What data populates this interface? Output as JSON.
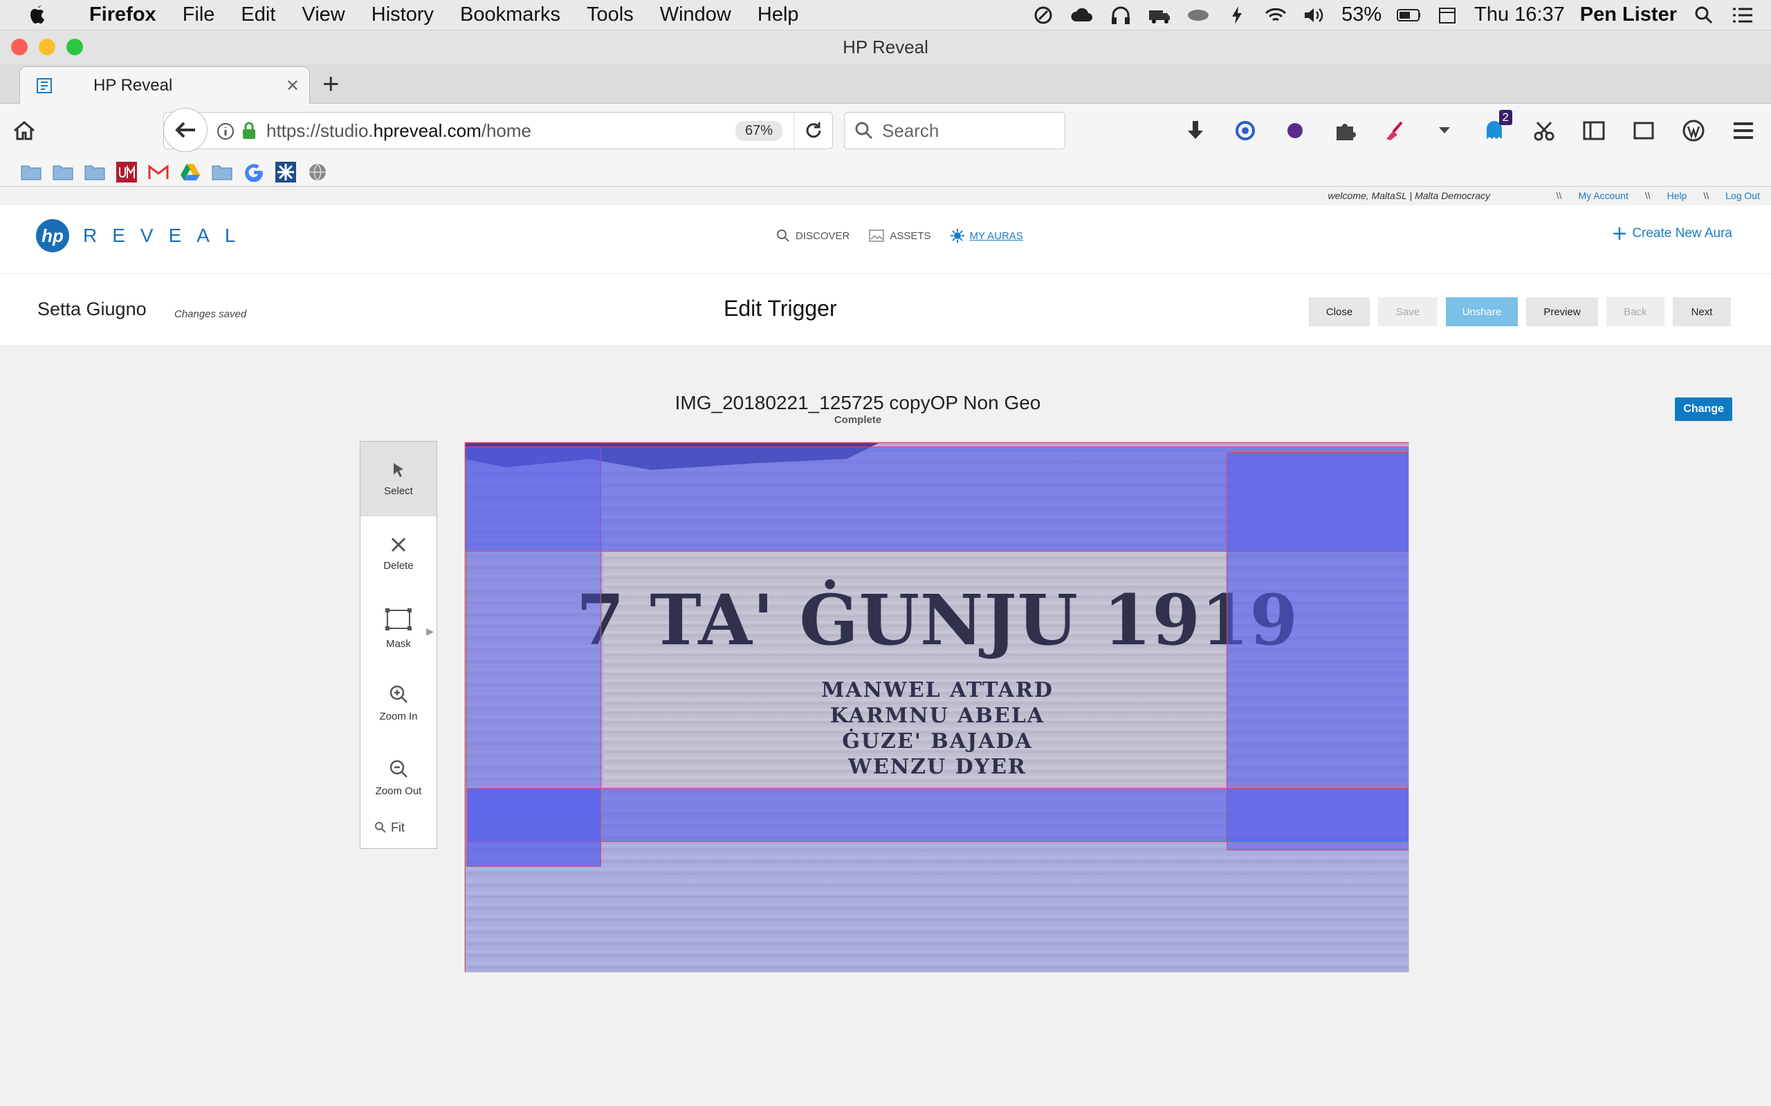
{
  "menubar": {
    "app": "Firefox",
    "items": [
      "File",
      "Edit",
      "View",
      "History",
      "Bookmarks",
      "Tools",
      "Window",
      "Help"
    ],
    "battery": "53%",
    "clock": "Thu 16:37",
    "user": "Pen Lister"
  },
  "window": {
    "title": "HP Reveal"
  },
  "tabs": [
    {
      "label": "HP Reveal"
    }
  ],
  "navbar": {
    "url_prefix": "https://studio.",
    "url_domain": "hpreveal.com",
    "url_path": "/home",
    "zoom": "67%",
    "search_placeholder": "Search",
    "notification_count": "2"
  },
  "site": {
    "welcome": "welcome, MaltaSL | Malta Democracy",
    "links": [
      "My Account",
      "Help",
      "Log Out"
    ],
    "separator": "\\\\",
    "logo_mark": "hp",
    "logo_text": "REVEAL",
    "nav": [
      {
        "label": "DISCOVER",
        "icon": "search-icon"
      },
      {
        "label": "ASSETS",
        "icon": "image-icon"
      },
      {
        "label": "MY AURAS",
        "icon": "aura-icon",
        "active": true
      }
    ],
    "create_new": "Create New Aura"
  },
  "editbar": {
    "aura_name": "Setta Giugno",
    "saved_note": "Changes saved",
    "title": "Edit Trigger",
    "buttons": [
      {
        "label": "Close",
        "state": "normal"
      },
      {
        "label": "Save",
        "state": "disabled"
      },
      {
        "label": "Unshare",
        "state": "primary"
      },
      {
        "label": "Preview",
        "state": "normal"
      },
      {
        "label": "Back",
        "state": "disabled"
      },
      {
        "label": "Next",
        "state": "normal"
      }
    ]
  },
  "trigger": {
    "file_name": "IMG_20180221_125725 copyOP Non Geo",
    "status": "Complete",
    "change_label": "Change",
    "tools": [
      {
        "label": "Select",
        "icon": "cursor-icon"
      },
      {
        "label": "Delete",
        "icon": "close-icon"
      },
      {
        "label": "Mask",
        "icon": "mask-icon"
      },
      {
        "label": "Zoom In",
        "icon": "zoom-in-icon"
      },
      {
        "label": "Zoom Out",
        "icon": "zoom-out-icon"
      }
    ],
    "fit_label": "Fit",
    "inscription": {
      "date": "7 TA' ĠUNJU 1919",
      "names": [
        "MANWEL  ATTARD",
        "KARMNU  ABELA",
        "ĠUZE' BAJADA",
        "WENZU  DYER"
      ]
    }
  }
}
